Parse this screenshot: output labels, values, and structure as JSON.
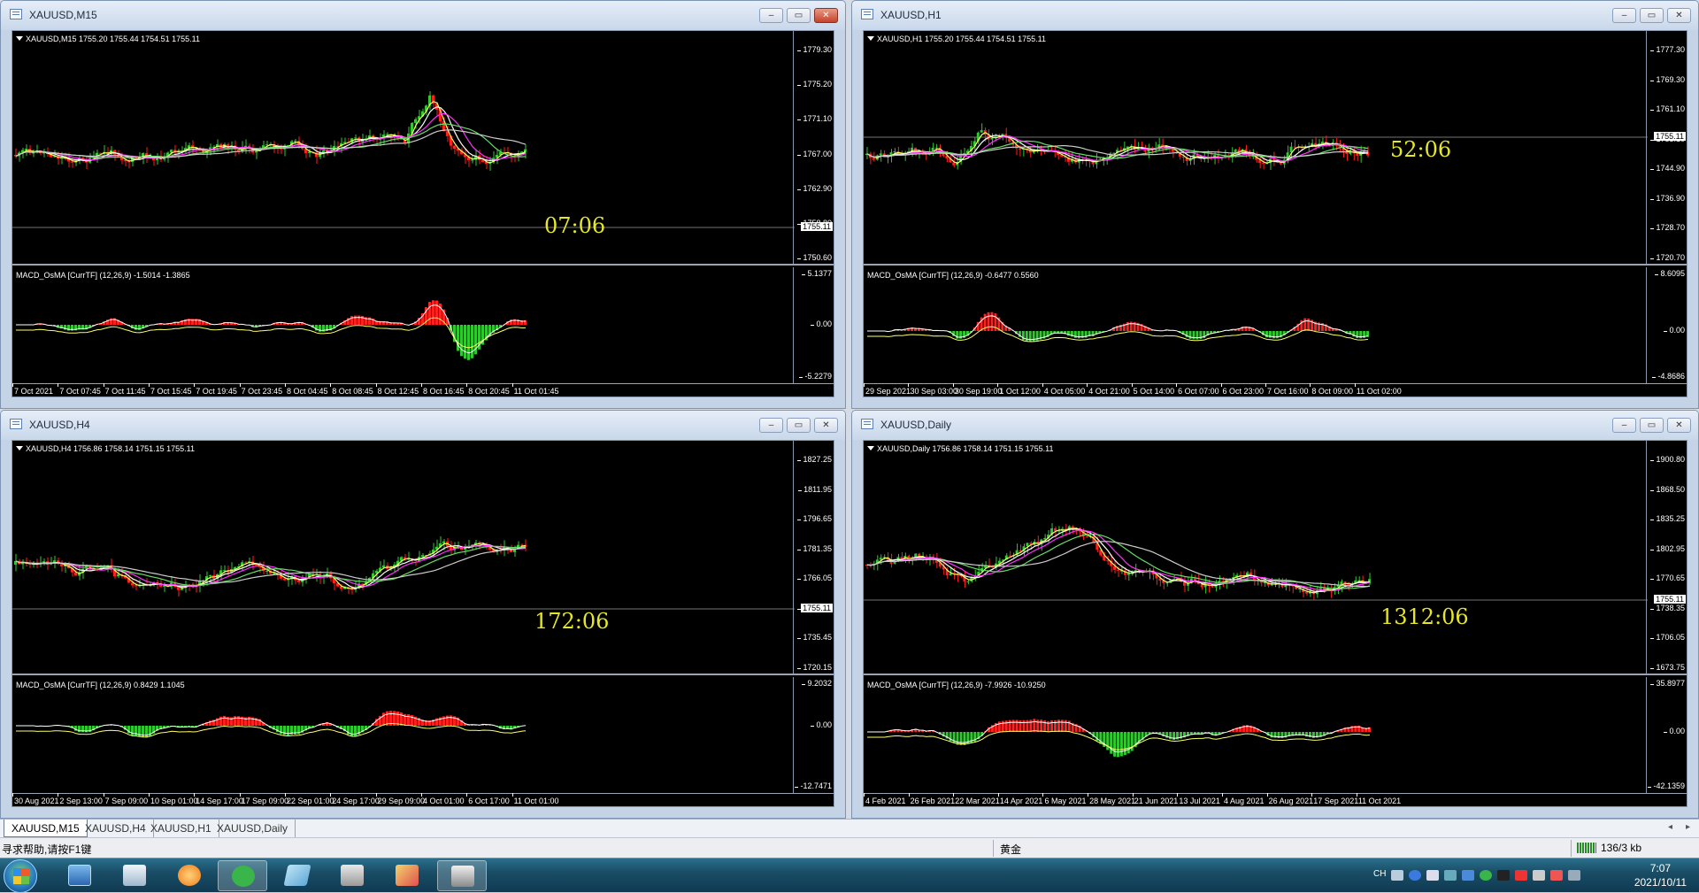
{
  "windows": [
    {
      "title": "XAUUSD,M15",
      "info": "XAUUSD,M15  1755.20 1755.44 1754.51 1755.11",
      "macd_info": "MACD_OsMA [CurrTF] (12,26,9) -1.5014 -1.3865",
      "price_ticks": [
        "1779.30",
        "1775.20",
        "1771.10",
        "1767.00",
        "1762.90",
        "1758.80",
        "1750.60"
      ],
      "current_price": "1755.11",
      "macd_ticks": [
        "5.1377",
        "0.00",
        "-5.2279"
      ],
      "timer": "07:06",
      "x_ticks": [
        "7 Oct 2021",
        "7 Oct 07:45",
        "7 Oct 11:45",
        "7 Oct 15:45",
        "7 Oct 19:45",
        "7 Oct 23:45",
        "8 Oct 04:45",
        "8 Oct 08:45",
        "8 Oct 12:45",
        "8 Oct 16:45",
        "8 Oct 20:45",
        "11 Oct 01:45"
      ],
      "close_highlight": true
    },
    {
      "title": "XAUUSD,H1",
      "info": "XAUUSD,H1  1755.20 1755.44 1754.51 1755.11",
      "macd_info": "MACD_OsMA [CurrTF] (12,26,9) -0.6477 0.5560",
      "price_ticks": [
        "1777.30",
        "1769.30",
        "1761.10",
        "1753.10",
        "1744.90",
        "1736.90",
        "1728.70",
        "1720.70"
      ],
      "current_price": "1755.11",
      "macd_ticks": [
        "8.6095",
        "0.00",
        "-4.8686"
      ],
      "timer": "52:06",
      "x_ticks": [
        "29 Sep 2021",
        "30 Sep 03:00",
        "30 Sep 19:00",
        "1 Oct 12:00",
        "4 Oct 05:00",
        "4 Oct 21:00",
        "5 Oct 14:00",
        "6 Oct 07:00",
        "6 Oct 23:00",
        "7 Oct 16:00",
        "8 Oct 09:00",
        "11 Oct 02:00"
      ],
      "close_highlight": false
    },
    {
      "title": "XAUUSD,H4",
      "info": "XAUUSD,H4  1756.86 1758.14 1751.15 1755.11",
      "macd_info": "MACD_OsMA [CurrTF] (12,26,9) 0.8429 1.1045",
      "price_ticks": [
        "1827.25",
        "1811.95",
        "1796.65",
        "1781.35",
        "1766.05",
        "1750.75",
        "1735.45",
        "1720.15"
      ],
      "current_price": "1755.11",
      "macd_ticks": [
        "9.2032",
        "0.00",
        "-12.7471"
      ],
      "timer": "172:06",
      "x_ticks": [
        "30 Aug 2021",
        "2 Sep 13:00",
        "7 Sep 09:00",
        "10 Sep 01:00",
        "14 Sep 17:00",
        "17 Sep 09:00",
        "22 Sep 01:00",
        "24 Sep 17:00",
        "29 Sep 09:00",
        "4 Oct 01:00",
        "6 Oct 17:00",
        "11 Oct 01:00"
      ],
      "close_highlight": false
    },
    {
      "title": "XAUUSD,Daily",
      "info": "XAUUSD,Daily  1756.86 1758.14 1751.15 1755.11",
      "macd_info": "MACD_OsMA [CurrTF] (12,26,9) -7.9926 -10.9250",
      "price_ticks": [
        "1900.80",
        "1868.50",
        "1835.25",
        "1802.95",
        "1770.65",
        "1738.35",
        "1706.05",
        "1673.75"
      ],
      "current_price": "1755.11",
      "macd_ticks": [
        "35.8977",
        "0.00",
        "-42.1359"
      ],
      "timer": "1312:06",
      "x_ticks": [
        "4 Feb 2021",
        "26 Feb 2021",
        "22 Mar 2021",
        "14 Apr 2021",
        "6 May 2021",
        "28 May 2021",
        "21 Jun 2021",
        "13 Jul 2021",
        "4 Aug 2021",
        "26 Aug 2021",
        "17 Sep 2021",
        "11 Oct 2021"
      ],
      "close_highlight": false
    }
  ],
  "tabs": [
    "XAUUSD,M15",
    "XAUUSD,H4",
    "XAUUSD,H1",
    "XAUUSD,Daily"
  ],
  "status": {
    "help": "寻求帮助,请按F1键",
    "profile": "黄金",
    "traffic": "136/3 kb"
  },
  "taskbar": {
    "time": "7:07",
    "date": "2021/10/11",
    "lang": "CH"
  },
  "colors": {
    "bull": "#32c832",
    "bear": "#ff2020",
    "ma_fast": "#ffff66",
    "ma_white": "#ffffff",
    "ma_magenta": "#ff30ff",
    "ma_green": "#66dd66",
    "ma_gray": "#cccccc",
    "timer": "#e6e62a"
  },
  "icons": [
    "windows-start-icon",
    "desktop-icon",
    "contacts-icon",
    "browser-icon",
    "wechat-icon",
    "document-icon",
    "app-icon",
    "paint-icon",
    "metatrader-icon"
  ]
}
